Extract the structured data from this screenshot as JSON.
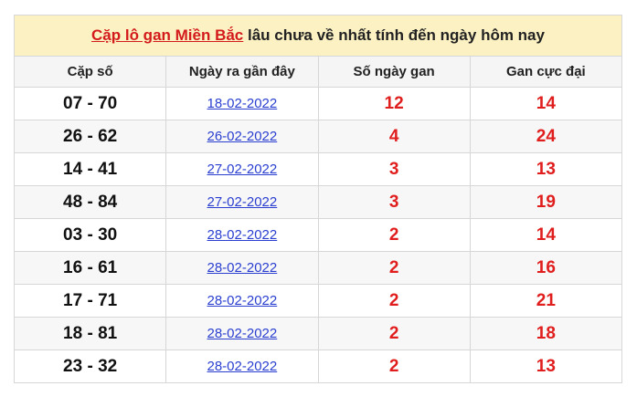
{
  "title": {
    "link_text": "Cặp lô gan Miền Bắc",
    "rest_text": " lâu chưa về nhất tính đến ngày hôm nay"
  },
  "headers": [
    "Cặp số",
    "Ngày ra gần đây",
    "Số ngày gan",
    "Gan cực đại"
  ],
  "rows": [
    {
      "pair": "07 - 70",
      "date": "18-02-2022",
      "days": "12",
      "max": "14"
    },
    {
      "pair": "26 - 62",
      "date": "26-02-2022",
      "days": "4",
      "max": "24"
    },
    {
      "pair": "14 - 41",
      "date": "27-02-2022",
      "days": "3",
      "max": "13"
    },
    {
      "pair": "48 - 84",
      "date": "27-02-2022",
      "days": "3",
      "max": "19"
    },
    {
      "pair": "03 - 30",
      "date": "28-02-2022",
      "days": "2",
      "max": "14"
    },
    {
      "pair": "16 - 61",
      "date": "28-02-2022",
      "days": "2",
      "max": "16"
    },
    {
      "pair": "17 - 71",
      "date": "28-02-2022",
      "days": "2",
      "max": "21"
    },
    {
      "pair": "18 - 81",
      "date": "28-02-2022",
      "days": "2",
      "max": "18"
    },
    {
      "pair": "23 - 32",
      "date": "28-02-2022",
      "days": "2",
      "max": "13"
    }
  ]
}
